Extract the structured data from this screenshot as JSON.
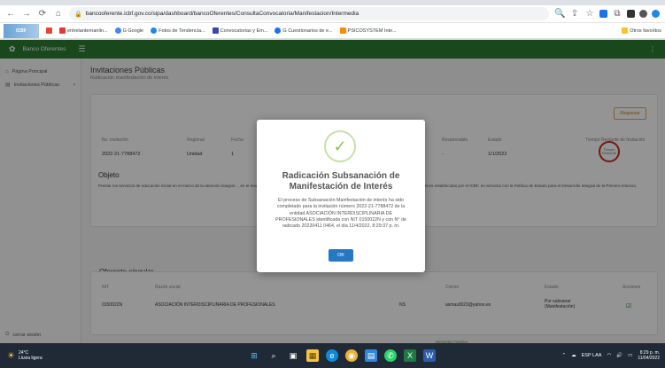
{
  "browser": {
    "url": "bancooferente.icbf.gov.co/sipa/dashboard/bancoOferentes/ConsultaConvocatoria/Manifestacion/Intermedia",
    "bookmarks": [
      {
        "label": "entrelanternanlin...",
        "color": "#e53935"
      },
      {
        "label": "G Google",
        "color": "#4285f4"
      },
      {
        "label": "Fotos de Tendencia...",
        "color": "#1e88e5"
      },
      {
        "label": "Convocatorias y Em...",
        "color": "#3949ab"
      },
      {
        "label": "G Cuestionarios de e...",
        "color": "#1a73e8"
      },
      {
        "label": "PSICOSYSTEM Inte...",
        "color": "#fb8c00"
      },
      {
        "label": "Otros favoritos",
        "color": "#fbc02d"
      }
    ]
  },
  "app": {
    "brand": "Banco Oferentes",
    "sidebar": {
      "items": [
        {
          "label": "Página Principal"
        },
        {
          "label": "Invitaciones Públicas"
        }
      ],
      "logout": "cerrar sesión"
    },
    "page": {
      "title": "Invitaciones Públicas",
      "subtitle": "Radicación manifestación de interés",
      "regresar": "Regresar",
      "invitation_headers": [
        "No. invitación",
        "Regional",
        "Fecha",
        "Responsable",
        "Estado",
        "Tiempo Restante de Invitación"
      ],
      "invitation_row": {
        "numero": "2022-21-7788472",
        "regional": "Unidad",
        "col3": "1",
        "responsable": "-",
        "estado": "1/1/2022",
        "badge": "Tiempo Restante"
      },
      "objeto_title": "Objeto",
      "objeto_text": "Prestar los servicios de educación inicial en el marco de la atención integral ... en el modalidad institucional, el Lineamiento Técnico para la Atención a la Primera Infancia y las directrices establecidas por el ICBF, en armonía con la Política de Estado para el Desarrollo Integral de la Primera Infancia.",
      "oferente_title": "Oferente singular",
      "oferente_headers": [
        "NIT",
        "Razón social",
        "",
        "Correo",
        "Estado",
        "Acciones"
      ],
      "oferente_row": {
        "nit": "0150022N",
        "razon": "ASOCIACIÓN INTERDISCIPLINARIA DE PROFESIONALES",
        "num": "NS",
        "correo": "asmas0023@yahoo.es",
        "estado": "Por subsanar (Manifestación)"
      },
      "footer": "Bienestar Familiar"
    }
  },
  "modal": {
    "title": "Radicación Subsanación de Manifestación de Interés",
    "body": "El proceso de Subsanación Manifestación de interés ha sido completado para la invitación número 2022-21-7788472 de la entidad ASOCIACIÓN INTERDISCIPLINARIA DE PROFESIONALES identificada con NIT 0150022N y con N° de radicado 20220411 0464, el día 11/4/2022, 8:29:37 p. m.",
    "ok_label": "OK"
  },
  "taskbar": {
    "weather_temp": "24°C",
    "weather_desc": "Lluvia ligera",
    "lang": "ESP LAA",
    "time": "8:29 p. m.",
    "date": "11/04/2022"
  },
  "colors": {
    "app_green": "#2e7d32",
    "modal_ok_blue": "#2778c4",
    "success_check": "#8bc34a",
    "highlight_red": "#c62828"
  }
}
